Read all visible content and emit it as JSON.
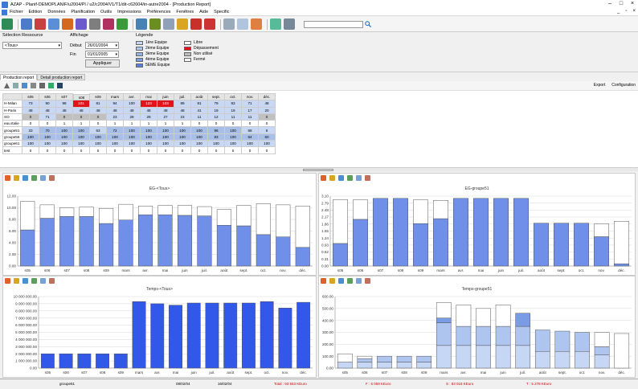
{
  "window": {
    "title": "AZAP - Planif-DEMOPLANIF/u2004/Pl / u2/c2004/V1/T1/dit-c62004/in-autre2004 - [Production Report]"
  },
  "menu": [
    "Fichier",
    "Edition",
    "Données",
    "Planification",
    "Outils",
    "Impressions",
    "Préférences",
    "Fenêtres",
    "Aide",
    "Specific"
  ],
  "mdi": [
    "_",
    "▫",
    "×"
  ],
  "filters": {
    "resource_group_label": "Sélection Ressource",
    "resource_value": "<Tous>",
    "display_group_label": "Affichage",
    "start_label": "Début",
    "start_value": "26/01/2004",
    "end_label": "Fin",
    "end_value": "01/01/2005",
    "apply_label": "Appliquer"
  },
  "legend": {
    "title": "Légende",
    "left": [
      {
        "label": "1ère Equipe",
        "color": "#c6d6f5"
      },
      {
        "label": "2ème Equipe",
        "color": "#aec5f0"
      },
      {
        "label": "3ème Equipe",
        "color": "#94b2ea"
      },
      {
        "label": "4ème Equipe",
        "color": "#7a9be6"
      },
      {
        "label": "5EME Equipe",
        "color": "#5b7fe0"
      }
    ],
    "right": [
      {
        "label": "Libre",
        "color": "#ffffff"
      },
      {
        "label": "Dépassement",
        "color": "#e3131b"
      },
      {
        "label": "Non utilisé",
        "color": "#bdbdbd"
      },
      {
        "label": "Fermé",
        "color": "#f2f2f2"
      }
    ]
  },
  "tabs": [
    "Production report",
    "Detail production report"
  ],
  "grid_toolbar": {
    "export_label": "Export",
    "config_label": "Configuration"
  },
  "grid": {
    "columns": [
      "s05",
      "s06",
      "s07",
      "s08",
      "s09",
      "mars",
      "avr.",
      "mai",
      "juin",
      "juil.",
      "août",
      "sept.",
      "oct.",
      "nov.",
      "déc."
    ],
    "rows": [
      {
        "label": "H-Milan",
        "cells": [
          "73",
          "90",
          "98",
          "101",
          "81",
          "94",
          "100",
          "123",
          "103",
          "89",
          "81",
          "79",
          "83",
          "71",
          "48"
        ],
        "styles": [
          "lb",
          "lb",
          "lb",
          "red",
          "lb",
          "lb",
          "lb",
          "red",
          "red",
          "lb",
          "lb",
          "lb",
          "lb",
          "lb",
          "lb"
        ]
      },
      {
        "label": "H-Paris",
        "cells": [
          "48",
          "48",
          "48",
          "48",
          "48",
          "48",
          "48",
          "48",
          "48",
          "48",
          "41",
          "19",
          "19",
          "17",
          "20"
        ],
        "styles": [
          "lb",
          "lb",
          "lb",
          "lb",
          "lb",
          "lb",
          "lb",
          "lb",
          "lb",
          "lb",
          "lb",
          "lb",
          "lb",
          "lb",
          "lb"
        ]
      },
      {
        "label": "SO",
        "cells": [
          "0",
          "71",
          "0",
          "0",
          "0",
          "23",
          "28",
          "29",
          "27",
          "23",
          "11",
          "12",
          "11",
          "11",
          "0"
        ],
        "styles": [
          "grey",
          "lb",
          "grey",
          "grey",
          "grey",
          "lb",
          "lb",
          "lb",
          "lb",
          "lb",
          "lb",
          "lb",
          "lb",
          "lb",
          "grey"
        ]
      },
      {
        "label": "eau.Italie",
        "cells": [
          "0",
          "0",
          "1",
          "1",
          "0",
          "1",
          "1",
          "1",
          "1",
          "1",
          "0",
          "0",
          "0",
          "0",
          "0"
        ],
        "styles": [
          "",
          "",
          "",
          "",
          "",
          "",
          "",
          "",
          "",
          "",
          "",
          "",
          "",
          "",
          ""
        ]
      },
      {
        "label": "groupe51",
        "cells": [
          "33",
          "70",
          "100",
          "100",
          "63",
          "72",
          "100",
          "100",
          "100",
          "100",
          "100",
          "96",
          "100",
          "68",
          "6"
        ],
        "styles": [
          "lb",
          "hl",
          "hl",
          "hl",
          "lb",
          "hl",
          "hl",
          "hl",
          "hl",
          "hl",
          "hl",
          "hl",
          "hl",
          "lb",
          "lb"
        ]
      },
      {
        "label": "groupe56",
        "cells": [
          "100",
          "100",
          "100",
          "100",
          "100",
          "100",
          "100",
          "100",
          "100",
          "100",
          "100",
          "83",
          "100",
          "64",
          "60"
        ],
        "styles": [
          "hl",
          "hl",
          "hl",
          "hl",
          "hl",
          "hl",
          "hl",
          "hl",
          "hl",
          "hl",
          "hl",
          "hl",
          "hl",
          "hl",
          "hl"
        ]
      },
      {
        "label": "groupe61",
        "cells": [
          "100",
          "100",
          "100",
          "100",
          "100",
          "100",
          "100",
          "100",
          "100",
          "100",
          "100",
          "100",
          "100",
          "100",
          "100"
        ],
        "styles": [
          "lb",
          "lb",
          "lb",
          "lb",
          "lb",
          "lb",
          "lb",
          "lb",
          "lb",
          "lb",
          "lb",
          "lb",
          "lb",
          "lb",
          "lb"
        ]
      },
      {
        "label": "test",
        "cells": [
          "0",
          "0",
          "0",
          "0",
          "0",
          "0",
          "0",
          "0",
          "0",
          "0",
          "0",
          "0",
          "0",
          "0",
          "0"
        ],
        "styles": [
          "",
          "",
          "",
          "",
          "",
          "",
          "",
          "",
          "",
          "",
          "",
          "",
          "",
          "",
          ""
        ]
      }
    ]
  },
  "chart_data": [
    {
      "type": "bar",
      "title": "EG-<Tous>",
      "categories": [
        "s05",
        "s06",
        "s07",
        "s08",
        "s09",
        "mars",
        "avr.",
        "mai",
        "juin",
        "juil.",
        "août",
        "sept.",
        "oct.",
        "nov.",
        "déc."
      ],
      "yticks": [
        "0.00",
        "2.00",
        "4.00",
        "6.00",
        "8.00",
        "10.00",
        "12.00"
      ],
      "ylim": [
        0,
        12
      ],
      "series": [
        {
          "values": [
            6.2,
            8.2,
            8.5,
            8.5,
            7.3,
            7.9,
            8.8,
            8.8,
            8.7,
            8.6,
            7.0,
            6.9,
            5.4,
            5.0,
            3.2
          ],
          "color": "#6f8fe8"
        },
        {
          "values": [
            4.9,
            2.3,
            1.5,
            1.6,
            2.6,
            2.7,
            1.5,
            1.6,
            1.7,
            1.6,
            2.7,
            3.5,
            5.3,
            5.5,
            7.1
          ],
          "color": "#ffffff"
        }
      ]
    },
    {
      "type": "bar",
      "title": "EG-groupe51",
      "categories": [
        "s05",
        "s06",
        "s07",
        "s08",
        "s09",
        "mars",
        "avr.",
        "mai",
        "juin",
        "juil.",
        "août",
        "sept.",
        "oct.",
        "nov.",
        "déc."
      ],
      "yticks": [
        "0.00",
        "0.31",
        "0.62",
        "0.93",
        "1.24",
        "1.55",
        "1.86",
        "2.17",
        "2.48",
        "2.79",
        "3.10"
      ],
      "ylim": [
        0,
        3.1
      ],
      "series": [
        {
          "values": [
            1.0,
            2.07,
            3.0,
            3.0,
            1.88,
            2.1,
            3.0,
            3.0,
            3.0,
            3.0,
            1.9,
            1.9,
            1.9,
            1.3,
            0.1
          ],
          "color": "#6f8fe8"
        },
        {
          "values": [
            1.94,
            0.86,
            0,
            0,
            1.05,
            0.81,
            0,
            0,
            0,
            0,
            0,
            0,
            0,
            0.57,
            1.88
          ],
          "color": "#ffffff"
        }
      ]
    },
    {
      "type": "bar",
      "title": "Temps-<Tous>",
      "categories": [
        "s05",
        "s06",
        "s07",
        "s08",
        "s09",
        "mars",
        "avr.",
        "mai",
        "juin",
        "juil.",
        "août",
        "sept.",
        "oct.",
        "nov.",
        "déc."
      ],
      "yticks": [
        "0.00",
        "1 000 000.00",
        "2 000 000.00",
        "3 000 000.00",
        "4 000 000.00",
        "5 000 000.00",
        "6 000 000.00",
        "7 000 000.00",
        "8 000 000.00",
        "9 000 000.00",
        "10 000 000.00"
      ],
      "ylim": [
        0,
        10000000
      ],
      "series": [
        {
          "values": [
            2000000,
            2000000,
            2000000,
            2000000,
            2000000,
            9300000,
            9000000,
            8800000,
            9100000,
            9100000,
            9100000,
            9100000,
            9300000,
            8400000,
            9200000
          ],
          "color": "#3158e8"
        }
      ]
    },
    {
      "type": "bar",
      "title": "Temps-groupe51",
      "categories": [
        "s05",
        "s06",
        "s07",
        "s08",
        "s09",
        "mars",
        "avr.",
        "mai",
        "juin",
        "juil.",
        "août",
        "sept.",
        "oct.",
        "nov.",
        "déc."
      ],
      "yticks": [
        "0.00",
        "100.00",
        "200.00",
        "300.00",
        "400.00",
        "500.00",
        "600.00"
      ],
      "ylim": [
        0,
        600
      ],
      "series": [
        {
          "values": [
            50,
            50,
            50,
            50,
            50,
            190,
            190,
            190,
            190,
            190,
            140,
            140,
            140,
            110,
            0
          ],
          "color": "#c6d6f5"
        },
        {
          "values": [
            0,
            30,
            50,
            50,
            50,
            190,
            160,
            160,
            160,
            160,
            180,
            170,
            160,
            70,
            0
          ],
          "color": "#aec5f0"
        },
        {
          "values": [
            0,
            0,
            0,
            0,
            0,
            40,
            0,
            0,
            0,
            110,
            0,
            0,
            0,
            0,
            0
          ],
          "color": "#7a9be6"
        },
        {
          "values": [
            70,
            20,
            0,
            0,
            0,
            130,
            180,
            150,
            180,
            0,
            0,
            0,
            0,
            120,
            290
          ],
          "color": "#ffffff"
        }
      ]
    }
  ],
  "status": {
    "group": "groupe51",
    "date_start": "08/02/04",
    "date_end": "16/02/04",
    "total": "Total : 93 553 KEuro",
    "f": "F : 6 059 KEuro",
    "s": "S : 83 018 KEuro",
    "t": "T : 5 278 KEuro",
    "total_color": "#d40000"
  }
}
